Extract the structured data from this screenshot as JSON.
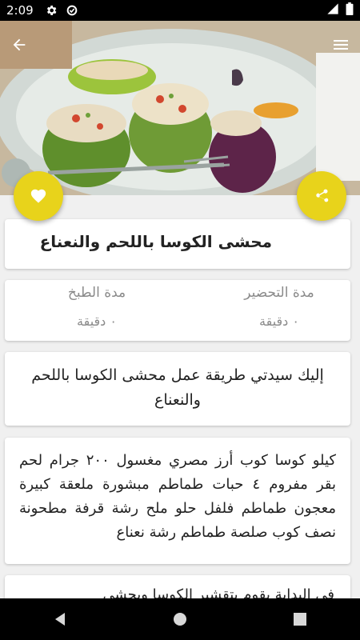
{
  "status_bar": {
    "time": "2:09"
  },
  "recipe": {
    "title": "محشى الكوسا باللحم والنعناع",
    "prep_label": "مدة التحضير",
    "prep_value": "٠ دقيقة",
    "cook_label": "مدة الطبخ",
    "cook_value": "٠ دقيقة",
    "intro": "إليك سيدتي طريقة عمل محشى الكوسا باللحم والنعناع",
    "ingredients": "كيلو كوسا كوب أرز مصري مغسول ٢٠٠ جرام لحم بقر مفروم ٤ حبات طماطم مبشورة ملعقة كبيرة معجون طماطم فلفل حلو ملح رشة قرفة مطحونة نصف كوب صلصة طماطم رشة نعناع",
    "next_text": "في البداية يقوم بتقشير الكوسا ويحشى"
  },
  "icons": {
    "back": "arrow-back-icon",
    "menu": "menu-icon",
    "favorite": "heart-icon",
    "share": "share-icon"
  },
  "colors": {
    "accent": "#e8d31b",
    "statusbar": "#000000"
  }
}
